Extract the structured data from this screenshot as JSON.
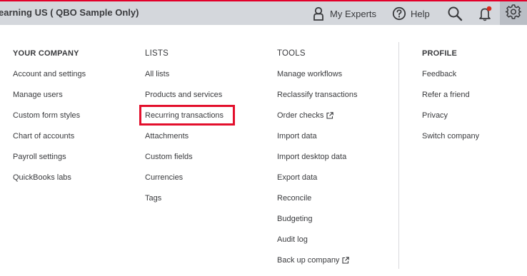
{
  "topbar": {
    "company_name": "earning US ( QBO Sample Only)",
    "my_experts_label": "My Experts",
    "help_label": "Help",
    "icons": [
      "experts-icon",
      "help-icon",
      "search-icon",
      "bell-icon",
      "gear-icon"
    ],
    "accent_color": "#e2002a",
    "notification_dot_color": "#d52b1e"
  },
  "menu": {
    "columns": [
      {
        "heading": "YOUR COMPANY",
        "items": [
          "Account and settings",
          "Manage users",
          "Custom form styles",
          "Chart of accounts",
          "Payroll settings",
          "QuickBooks labs"
        ]
      },
      {
        "heading": "LISTS",
        "items": [
          "All lists",
          "Products and services",
          "Recurring transactions",
          "Attachments",
          "Custom fields",
          "Currencies",
          "Tags"
        ]
      },
      {
        "heading": "TOOLS",
        "items": [
          "Manage workflows",
          "Reclassify transactions",
          "Order checks",
          "Import data",
          "Import desktop data",
          "Export data",
          "Reconcile",
          "Budgeting",
          "Audit log",
          "Back up company"
        ]
      },
      {
        "heading": "PROFILE",
        "items": [
          "Feedback",
          "Refer a friend",
          "Privacy",
          "Switch company"
        ]
      }
    ],
    "highlighted_item": "Recurring transactions",
    "highlight_color": "#e30f2c"
  }
}
